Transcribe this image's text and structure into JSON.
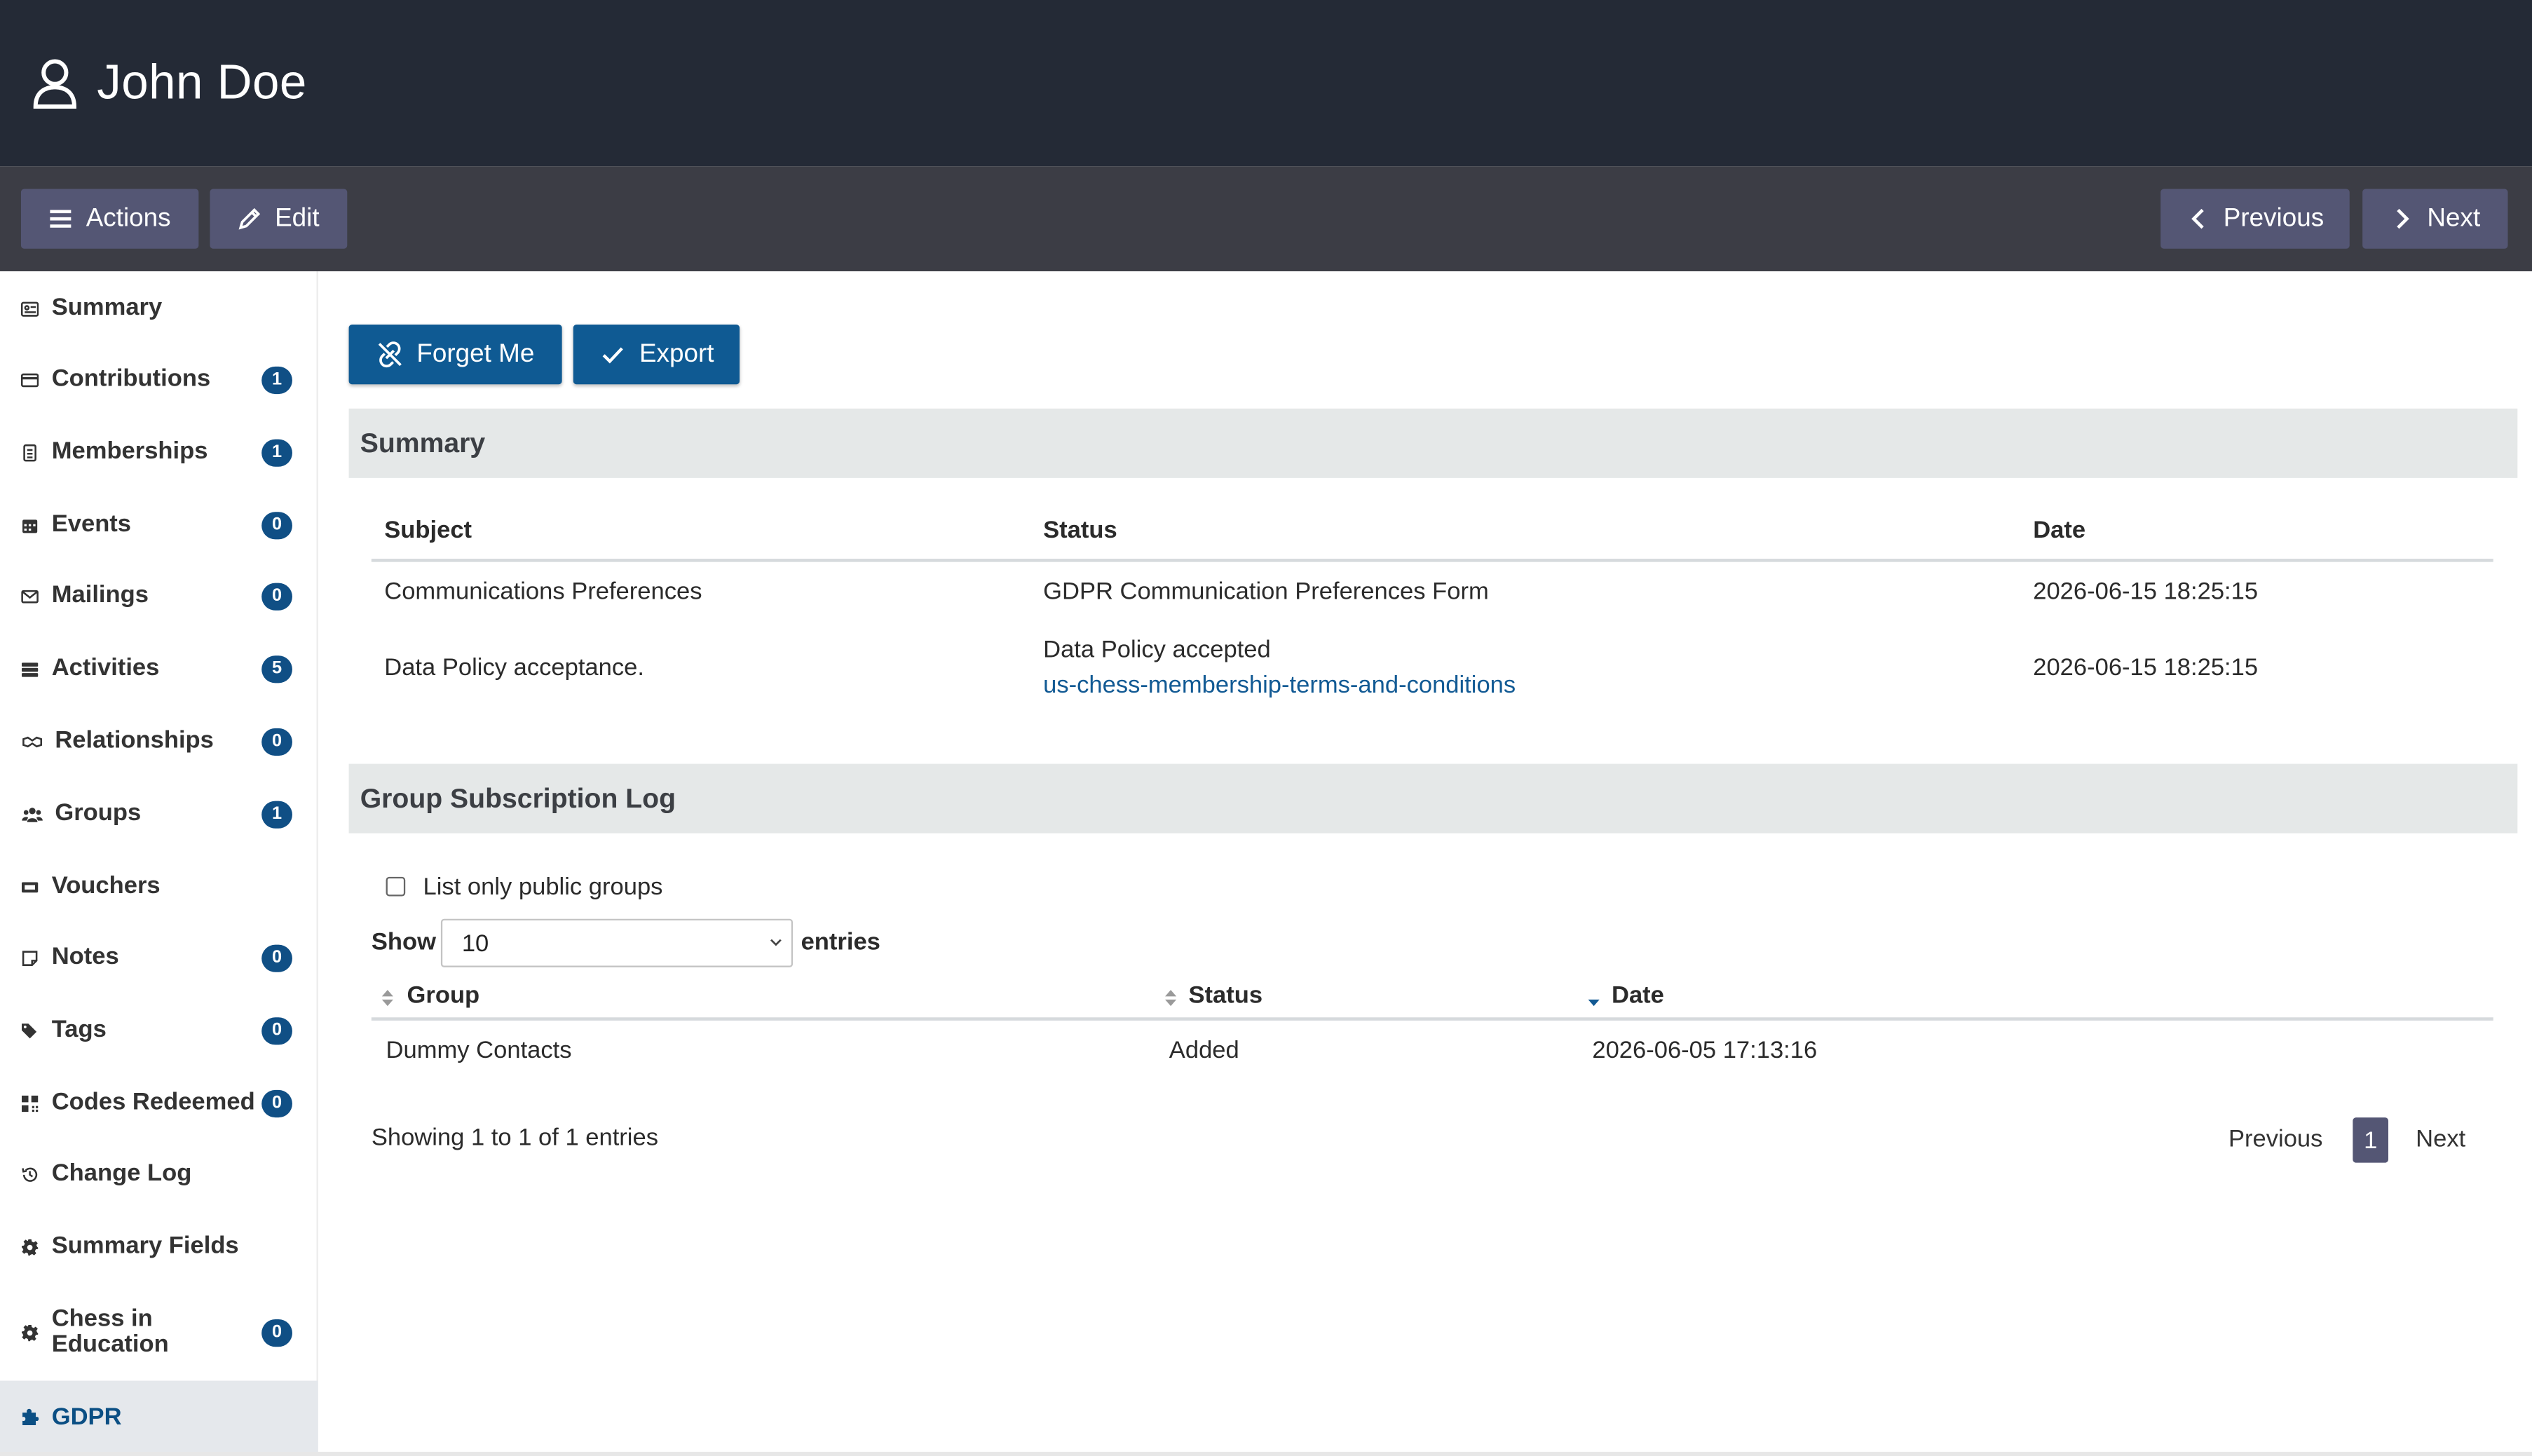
{
  "header": {
    "title": "John Doe"
  },
  "toolbar": {
    "actions": "Actions",
    "edit": "Edit",
    "previous": "Previous",
    "next": "Next"
  },
  "sidebar": {
    "items": [
      {
        "label": "Summary"
      },
      {
        "label": "Contributions",
        "count": "1"
      },
      {
        "label": "Memberships",
        "count": "1"
      },
      {
        "label": "Events",
        "count": "0"
      },
      {
        "label": "Mailings",
        "count": "0"
      },
      {
        "label": "Activities",
        "count": "5"
      },
      {
        "label": "Relationships",
        "count": "0"
      },
      {
        "label": "Groups",
        "count": "1"
      },
      {
        "label": "Vouchers"
      },
      {
        "label": "Notes",
        "count": "0"
      },
      {
        "label": "Tags",
        "count": "0"
      },
      {
        "label": "Codes Redeemed",
        "count": "0"
      },
      {
        "label": "Change Log"
      },
      {
        "label": "Summary Fields"
      },
      {
        "label": "Chess in Education",
        "line1": "Chess in",
        "line2": "Education",
        "count": "0"
      },
      {
        "label": "GDPR"
      }
    ]
  },
  "main": {
    "buttons": {
      "forget": "Forget Me",
      "export": "Export"
    },
    "summary": {
      "title": "Summary",
      "headers": {
        "subject": "Subject",
        "status": "Status",
        "date": "Date"
      },
      "rows": [
        {
          "subject": "Communications Preferences",
          "status": "GDPR Communication Preferences Form",
          "date": "2026-06-15 18:25:15"
        },
        {
          "subject": "Data Policy acceptance.",
          "status": "Data Policy accepted",
          "link": "us-chess-membership-terms-and-conditions",
          "date": "2026-06-15 18:25:15"
        }
      ]
    },
    "group_log": {
      "title": "Group Subscription Log",
      "public_only": "List only public groups",
      "show": "Show",
      "entries_value": "10",
      "entries": "entries",
      "headers": {
        "group": "Group",
        "status": "Status",
        "date": "Date"
      },
      "rows": [
        {
          "group": "Dummy Contacts",
          "status": "Added",
          "date": "2026-06-05 17:13:16"
        }
      ],
      "info": "Showing 1 to 1 of 1 entries",
      "pagination": {
        "previous": "Previous",
        "current": "1",
        "next": "Next"
      }
    }
  }
}
